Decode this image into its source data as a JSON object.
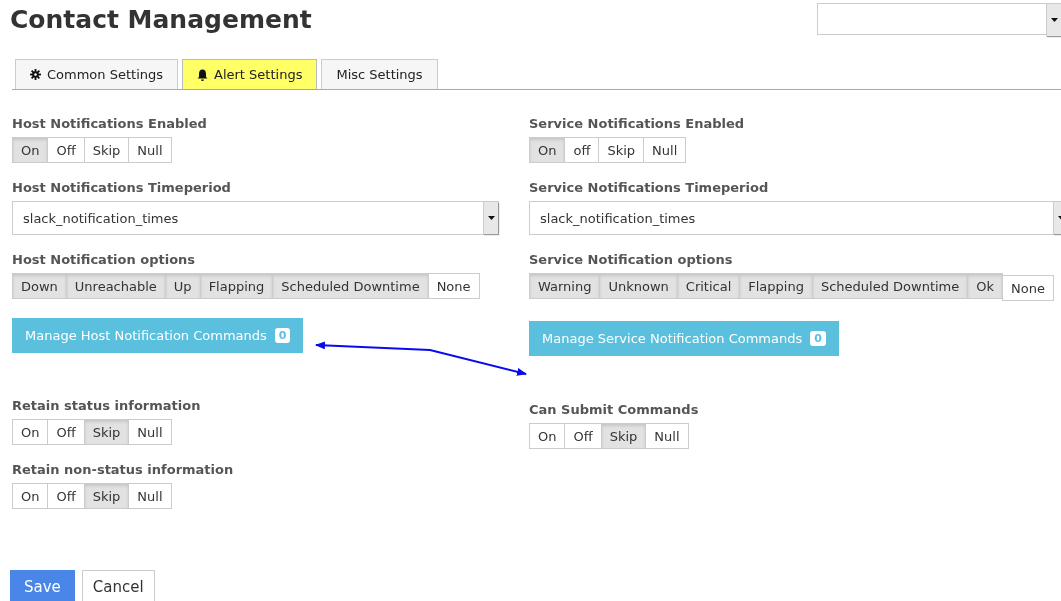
{
  "title": "Contact Management",
  "tabs": [
    {
      "label": "Common Settings",
      "kind": "gear",
      "selected": false
    },
    {
      "label": "Alert Settings",
      "kind": "bell",
      "selected": true
    },
    {
      "label": "Misc Settings",
      "kind": "plain",
      "selected": false
    }
  ],
  "columns": [
    {
      "fields": [
        {
          "kind": "toggle",
          "label": "Host Notifications Enabled",
          "options": [
            {
              "label": "On",
              "selected": true
            },
            {
              "label": "Off",
              "selected": false
            },
            {
              "label": "Skip",
              "selected": false
            },
            {
              "label": "Null",
              "selected": false
            }
          ]
        },
        {
          "kind": "select",
          "label": "Host Notifications Timeperiod",
          "value": "slack_notification_times"
        },
        {
          "kind": "toggle",
          "label": "Host Notification options",
          "options": [
            {
              "label": "Down",
              "selected": true
            },
            {
              "label": "Unreachable",
              "selected": true
            },
            {
              "label": "Up",
              "selected": true
            },
            {
              "label": "Flapping",
              "selected": true
            },
            {
              "label": "Scheduled Downtime",
              "selected": true
            },
            {
              "label": "None",
              "selected": false
            }
          ]
        },
        {
          "kind": "command",
          "label": "Manage Host Notification Commands",
          "count": "0"
        },
        {
          "kind": "toggle",
          "label": "Retain status information",
          "options": [
            {
              "label": "On",
              "selected": false
            },
            {
              "label": "Off",
              "selected": false
            },
            {
              "label": "Skip",
              "selected": true
            },
            {
              "label": "Null",
              "selected": false
            }
          ]
        },
        {
          "kind": "toggle",
          "label": "Retain non-status information",
          "options": [
            {
              "label": "On",
              "selected": false
            },
            {
              "label": "Off",
              "selected": false
            },
            {
              "label": "Skip",
              "selected": true
            },
            {
              "label": "Null",
              "selected": false
            }
          ]
        }
      ]
    },
    {
      "fields": [
        {
          "kind": "toggle",
          "label": "Service Notifications Enabled",
          "options": [
            {
              "label": "On",
              "selected": true
            },
            {
              "label": "off",
              "selected": false
            },
            {
              "label": "Skip",
              "selected": false
            },
            {
              "label": "Null",
              "selected": false
            }
          ]
        },
        {
          "kind": "select",
          "label": "Service Notifications Timeperiod",
          "value": "slack_notification_times"
        },
        {
          "kind": "toggle",
          "label": "Service Notification options",
          "options": [
            {
              "label": "Warning",
              "selected": true
            },
            {
              "label": "Unknown",
              "selected": true
            },
            {
              "label": "Critical",
              "selected": true
            },
            {
              "label": "Flapping",
              "selected": true
            },
            {
              "label": "Scheduled Downtime",
              "selected": true
            },
            {
              "label": "Ok",
              "selected": true
            },
            {
              "label": "None",
              "selected": false
            }
          ]
        },
        {
          "kind": "command",
          "label": "Manage Service Notification Commands",
          "count": "0"
        },
        {
          "kind": "toggle",
          "label": "Can Submit Commands",
          "options": [
            {
              "label": "On",
              "selected": false
            },
            {
              "label": "Off",
              "selected": false
            },
            {
              "label": "Skip",
              "selected": true
            },
            {
              "label": "Null",
              "selected": false
            }
          ]
        }
      ]
    }
  ],
  "footer": [
    {
      "label": "Save",
      "kind": "primary"
    },
    {
      "label": "Cancel",
      "kind": "default"
    }
  ]
}
